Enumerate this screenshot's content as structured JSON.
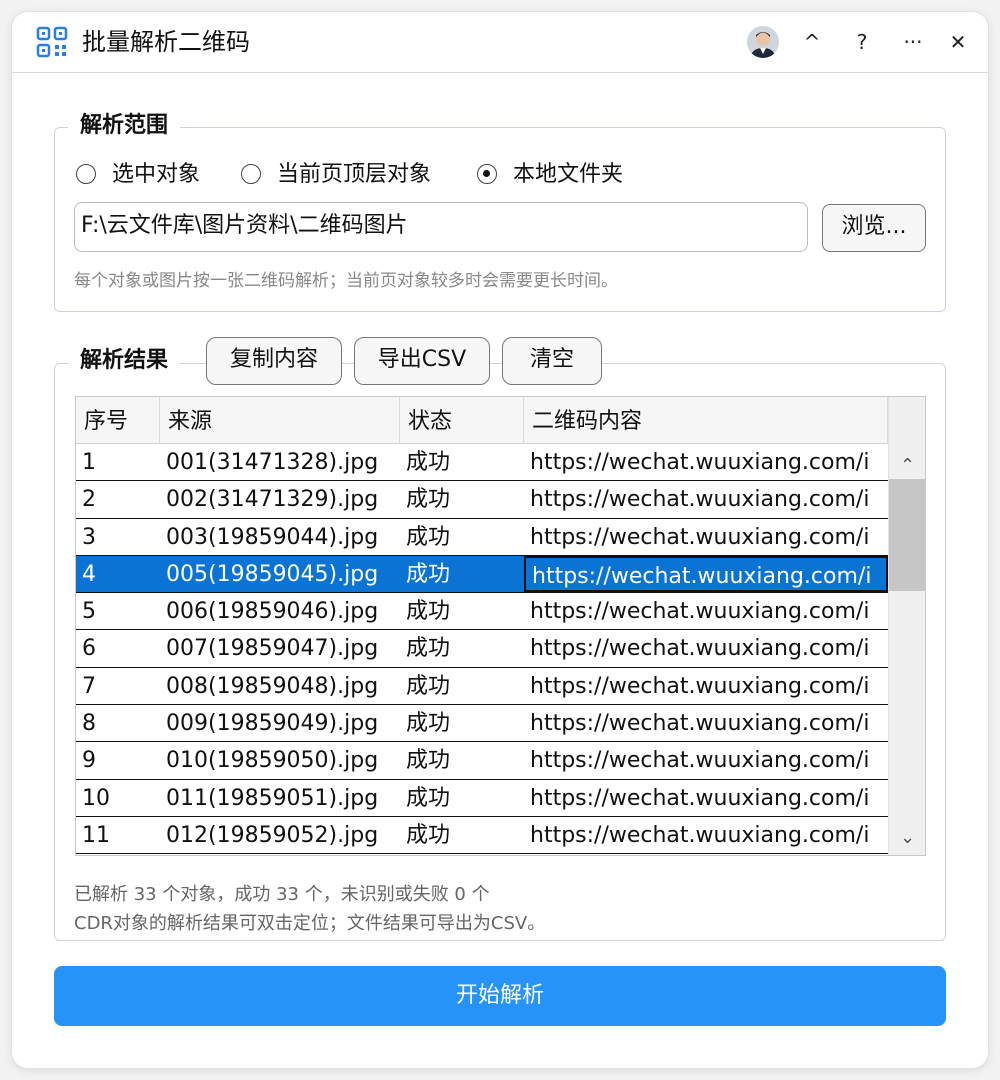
{
  "window": {
    "title": "批量解析二维码",
    "titlebar_buttons": {
      "collapse": "^",
      "help": "?",
      "more": "···",
      "close": "✕"
    }
  },
  "scope": {
    "legend": "解析范围",
    "options": [
      "选中对象",
      "当前页顶层对象",
      "本地文件夹"
    ],
    "selected_option": "本地文件夹",
    "path_value": "F:\\云文件库\\图片资料\\二维码图片",
    "browse_label": "浏览...",
    "hint": "每个对象或图片按一张二维码解析；当前页对象较多时会需要更长时间。"
  },
  "results": {
    "legend": "解析结果",
    "copy_label": "复制内容",
    "export_label": "导出CSV",
    "clear_label": "清空",
    "columns": [
      "序号",
      "来源",
      "状态",
      "二维码内容"
    ],
    "selected_row_index": 3,
    "rows": [
      [
        "1",
        "001(31471328).jpg",
        "成功",
        "https://wechat.wuuxiang.com/i"
      ],
      [
        "2",
        "002(31471329).jpg",
        "成功",
        "https://wechat.wuuxiang.com/i"
      ],
      [
        "3",
        "003(19859044).jpg",
        "成功",
        "https://wechat.wuuxiang.com/i"
      ],
      [
        "4",
        "005(19859045).jpg",
        "成功",
        "https://wechat.wuuxiang.com/i"
      ],
      [
        "5",
        "006(19859046).jpg",
        "成功",
        "https://wechat.wuuxiang.com/i"
      ],
      [
        "6",
        "007(19859047).jpg",
        "成功",
        "https://wechat.wuuxiang.com/i"
      ],
      [
        "7",
        "008(19859048).jpg",
        "成功",
        "https://wechat.wuuxiang.com/i"
      ],
      [
        "8",
        "009(19859049).jpg",
        "成功",
        "https://wechat.wuuxiang.com/i"
      ],
      [
        "9",
        "010(19859050).jpg",
        "成功",
        "https://wechat.wuuxiang.com/i"
      ],
      [
        "10",
        "011(19859051).jpg",
        "成功",
        "https://wechat.wuuxiang.com/i"
      ],
      [
        "11",
        "012(19859052).jpg",
        "成功",
        "https://wechat.wuuxiang.com/i"
      ]
    ],
    "status_line": "已解析 33 个对象，成功 33 个，未识别或失败 0 个",
    "note_line": "CDR对象的解析结果可双击定位；文件结果可导出为CSV。"
  },
  "start_label": "开始解析",
  "colors": {
    "accent": "#2593f7",
    "selected_row": "#0a73d4",
    "border": "#cdd4db"
  },
  "icons": {
    "app": "qr-code-icon",
    "scroll_up": "chevron-up-icon",
    "scroll_down": "chevron-down-icon"
  }
}
